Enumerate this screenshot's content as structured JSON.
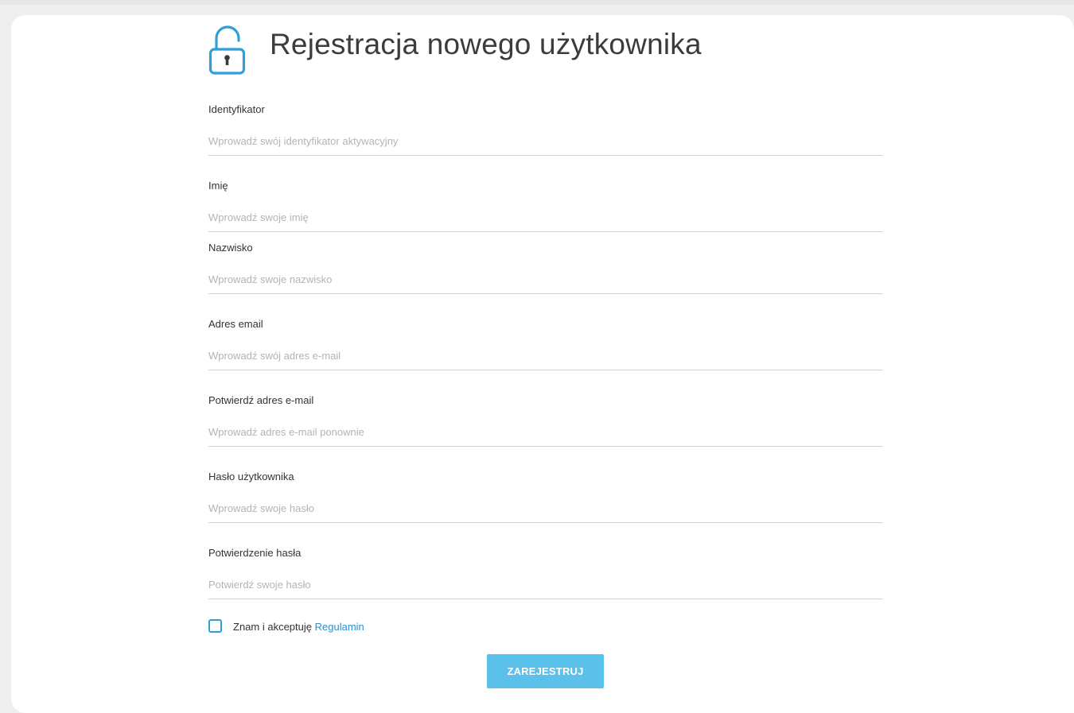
{
  "title": "Rejestracja nowego użytkownika",
  "colors": {
    "accent": "#2e9fd8",
    "button": "#5bc0ea",
    "background": "#efefef"
  },
  "icons": {
    "header": "lock-open-icon"
  },
  "fields": [
    {
      "label": "Identyfikator",
      "placeholder": "Wprowadź swój identyfikator aktywacyjny",
      "value": ""
    },
    {
      "label": "Imię",
      "placeholder": "Wprowadź swoje imię",
      "value": ""
    },
    {
      "label": "Nazwisko",
      "placeholder": "Wprowadź swoje nazwisko",
      "value": ""
    },
    {
      "label": "Adres email",
      "placeholder": "Wprowadź swój adres e-mail",
      "value": ""
    },
    {
      "label": "Potwierdź adres e-mail",
      "placeholder": "Wprowadź adres e-mail ponownie",
      "value": ""
    },
    {
      "label": "Hasło użytkownika",
      "placeholder": "Wprowadź swoje hasło",
      "value": ""
    },
    {
      "label": "Potwierdzenie hasła",
      "placeholder": "Potwierdź swoje hasło",
      "value": ""
    }
  ],
  "terms": {
    "checked": false,
    "text": "Znam i akceptuję",
    "link_label": "Regulamin"
  },
  "submit_label": "ZAREJESTRUJ"
}
